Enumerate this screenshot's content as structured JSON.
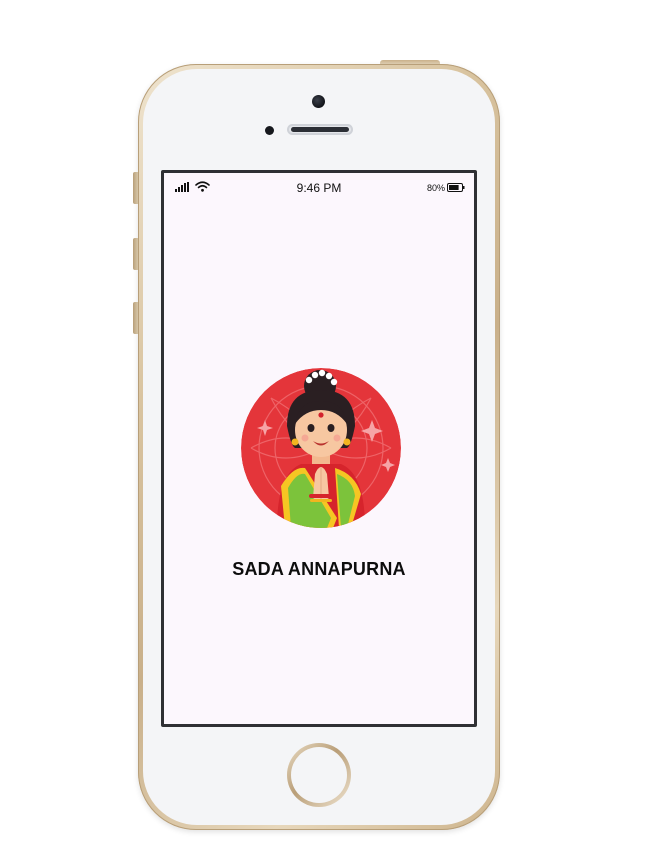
{
  "status_bar": {
    "signal_icon": "cellular-signal-icon",
    "wifi_icon": "wifi-icon",
    "time": "9:46 PM",
    "battery_percent": "80%",
    "battery_icon": "battery-icon",
    "battery_level": 0.8
  },
  "splash": {
    "avatar_icon": "woman-namaste-illustration",
    "title": "SADA ANNAPURNA"
  },
  "colors": {
    "screen_background": "#fcf7fd",
    "avatar_background": "#e4353a",
    "saree_green": "#7cc33b",
    "saree_yellow": "#f6c623",
    "title_text": "#0d0d0d"
  }
}
